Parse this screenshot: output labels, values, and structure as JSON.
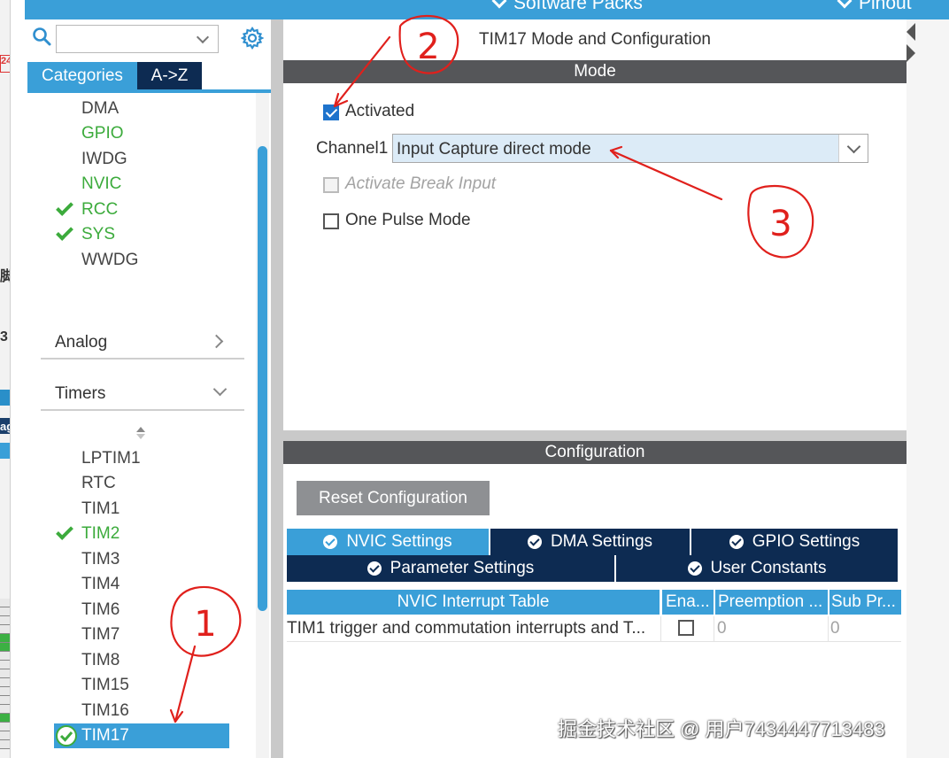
{
  "topbar": {
    "software_packs": "Software Packs",
    "pinout": "Pinout"
  },
  "leftstrip": {
    "red_label": "24",
    "char1": "脚",
    "char2": "3",
    "char3": "ag"
  },
  "sidebar": {
    "search_value": "",
    "tab_categories": "Categories",
    "tab_az": "A->Z",
    "system_items": [
      {
        "label": "DMA",
        "status": "none"
      },
      {
        "label": "GPIO",
        "status": "green"
      },
      {
        "label": "IWDG",
        "status": "none"
      },
      {
        "label": "NVIC",
        "status": "green"
      },
      {
        "label": "RCC",
        "status": "checked"
      },
      {
        "label": "SYS",
        "status": "checked"
      },
      {
        "label": "WWDG",
        "status": "none"
      }
    ],
    "section_analog": "Analog",
    "section_timers": "Timers",
    "timer_items": [
      {
        "label": "LPTIM1",
        "status": "none"
      },
      {
        "label": "RTC",
        "status": "none"
      },
      {
        "label": "TIM1",
        "status": "none"
      },
      {
        "label": "TIM2",
        "status": "checked"
      },
      {
        "label": "TIM3",
        "status": "none"
      },
      {
        "label": "TIM4",
        "status": "none"
      },
      {
        "label": "TIM6",
        "status": "none"
      },
      {
        "label": "TIM7",
        "status": "none"
      },
      {
        "label": "TIM8",
        "status": "none"
      },
      {
        "label": "TIM15",
        "status": "none"
      },
      {
        "label": "TIM16",
        "status": "none"
      },
      {
        "label": "TIM17",
        "status": "selected"
      }
    ]
  },
  "main": {
    "title": "TIM17 Mode and Configuration",
    "mode_header": "Mode",
    "activated_label": "Activated",
    "activated_checked": true,
    "channel1_label": "Channel1",
    "channel1_value": "Input Capture direct mode",
    "activate_break_label": "Activate Break Input",
    "one_pulse_label": "One Pulse Mode",
    "config_header": "Configuration",
    "reset_button": "Reset Configuration",
    "tabs": {
      "nvic": "NVIC Settings",
      "dma": "DMA Settings",
      "gpio": "GPIO Settings",
      "parameter": "Parameter Settings",
      "user_constants": "User Constants"
    },
    "table": {
      "headers": [
        "NVIC Interrupt Table",
        "Ena...",
        "Preemption ...",
        "Sub Pr..."
      ],
      "rows": [
        {
          "name": "TIM1 trigger and commutation interrupts and T...",
          "enabled": false,
          "preemption": "0",
          "sub": "0"
        }
      ]
    }
  },
  "annotations": {
    "mark1": "1",
    "mark2": "2",
    "mark3": "3"
  },
  "watermark": "掘金技术社区 @ 用户7434447713483",
  "colors": {
    "accent": "#3a9fd8",
    "navy": "#0d2b52",
    "header_gray": "#555659",
    "green": "#3cab3c",
    "annotation_red": "#e0201c"
  }
}
